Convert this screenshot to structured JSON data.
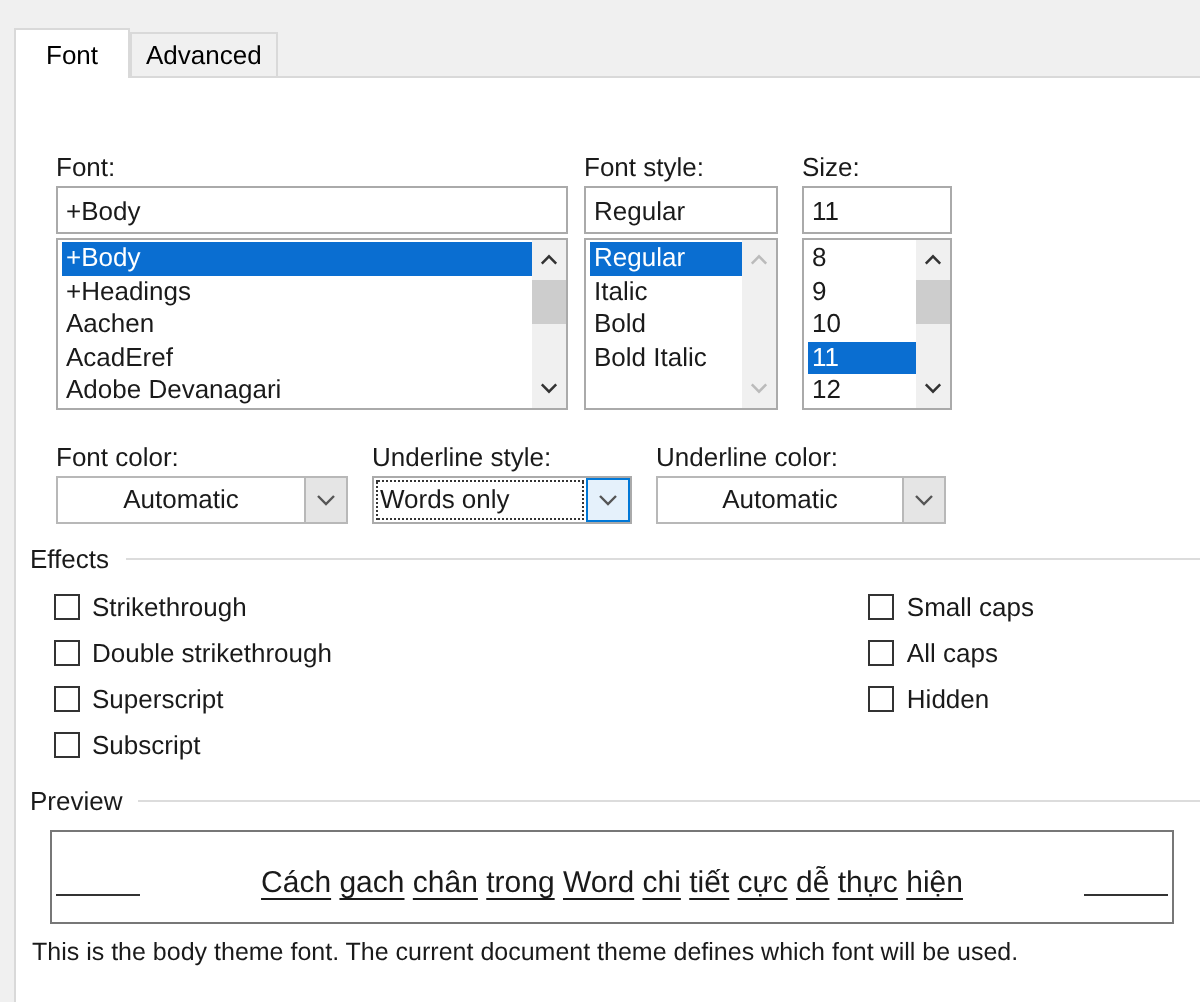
{
  "tabs": [
    {
      "label": "Font",
      "selected": true
    },
    {
      "label": "Advanced",
      "selected": false
    }
  ],
  "lists": [
    {
      "label": "Font:",
      "value": "+Body",
      "scrollable": true,
      "items": [
        {
          "text": "+Body",
          "selected": true
        },
        {
          "text": "+Headings",
          "selected": false
        },
        {
          "text": "Aachen",
          "selected": false
        },
        {
          "text": "AcadEref",
          "selected": false
        },
        {
          "text": "Adobe Devanagari",
          "selected": false
        }
      ]
    },
    {
      "label": "Font style:",
      "value": "Regular",
      "scrollable": false,
      "items": [
        {
          "text": "Regular",
          "selected": true
        },
        {
          "text": "Italic",
          "selected": false
        },
        {
          "text": "Bold",
          "selected": false
        },
        {
          "text": "Bold Italic",
          "selected": false
        }
      ]
    },
    {
      "label": "Size:",
      "value": "11",
      "scrollable": true,
      "items": [
        {
          "text": "8",
          "selected": false
        },
        {
          "text": "9",
          "selected": false
        },
        {
          "text": "10",
          "selected": false
        },
        {
          "text": "11",
          "selected": true
        },
        {
          "text": "12",
          "selected": false
        }
      ]
    }
  ],
  "dropdowns": [
    {
      "label": "Font color:",
      "value": "Automatic",
      "focused": false
    },
    {
      "label": "Underline style:",
      "value": "Words only",
      "focused": true
    },
    {
      "label": "Underline color:",
      "value": "Automatic",
      "focused": false
    }
  ],
  "effects": {
    "title": "Effects",
    "left": [
      {
        "label": "Strikethrough",
        "checked": false
      },
      {
        "label": "Double strikethrough",
        "checked": false
      },
      {
        "label": "Superscript",
        "checked": false
      },
      {
        "label": "Subscript",
        "checked": false
      }
    ],
    "right": [
      {
        "label": "Small caps",
        "checked": false
      },
      {
        "label": "All caps",
        "checked": false
      },
      {
        "label": "Hidden",
        "checked": false
      }
    ]
  },
  "preview": {
    "title": "Preview",
    "sample": "Cách gach chân trong Word chi tiết cực dễ thực hiện",
    "description": "This is the body theme font. The current document theme defines which font will be used."
  }
}
